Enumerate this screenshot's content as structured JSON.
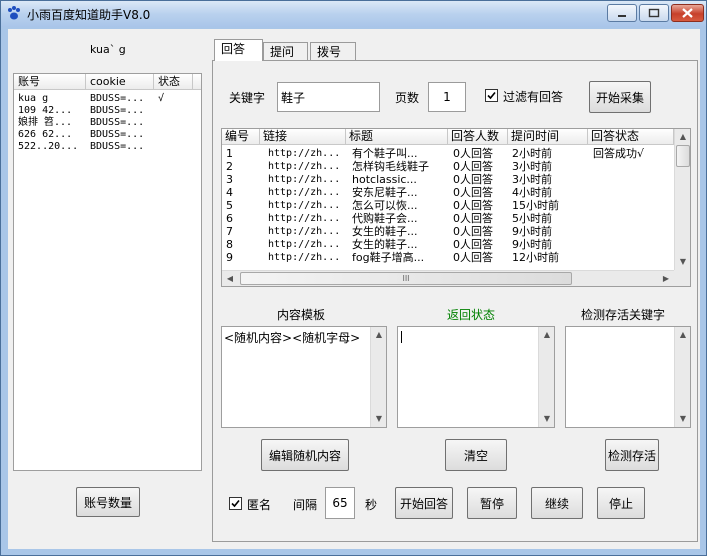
{
  "window": {
    "title": "小雨百度知道助手V8.0"
  },
  "left": {
    "account_name": "kua` g",
    "columns": [
      "账号",
      "cookie",
      "状态"
    ],
    "rows": [
      {
        "account": "kua  g",
        "cookie": "BDUSS=...",
        "status": "√"
      },
      {
        "account": "109  42...",
        "cookie": "BDUSS=...",
        "status": ""
      },
      {
        "account": "娘排  笤...",
        "cookie": "BDUSS=...",
        "status": ""
      },
      {
        "account": "626  62...",
        "cookie": "BDUSS=...",
        "status": ""
      },
      {
        "account": "522..20...",
        "cookie": "BDUSS=...",
        "status": ""
      }
    ],
    "account_count_button": "账号数量"
  },
  "tabs": [
    {
      "label": "回答"
    },
    {
      "label": "提问"
    },
    {
      "label": "拨号"
    }
  ],
  "search": {
    "keyword_label": "关键字",
    "keyword_value": "鞋子",
    "pages_label": "页数",
    "pages_value": "1",
    "filter_label": "过滤有回答",
    "filter_checked": true,
    "start_collect_button": "开始采集"
  },
  "results": {
    "columns": [
      "编号",
      "链接",
      "标题",
      "回答人数",
      "提问时间",
      "回答状态"
    ],
    "rows": [
      {
        "no": "1",
        "link": "http://zh...",
        "title": "有个鞋子叫...",
        "answers": "0人回答",
        "time": "2小时前",
        "status": "回答成功√"
      },
      {
        "no": "2",
        "link": "http://zh...",
        "title": "怎样钩毛线鞋子",
        "answers": "0人回答",
        "time": "3小时前",
        "status": ""
      },
      {
        "no": "3",
        "link": "http://zh...",
        "title": "hotclassic...",
        "answers": "0人回答",
        "time": "3小时前",
        "status": ""
      },
      {
        "no": "4",
        "link": "http://zh...",
        "title": "安东尼鞋子...",
        "answers": "0人回答",
        "time": "4小时前",
        "status": ""
      },
      {
        "no": "5",
        "link": "http://zh...",
        "title": "怎么可以恢...",
        "answers": "0人回答",
        "time": "15小时前",
        "status": ""
      },
      {
        "no": "6",
        "link": "http://zh...",
        "title": "代购鞋子会...",
        "answers": "0人回答",
        "time": "5小时前",
        "status": ""
      },
      {
        "no": "7",
        "link": "http://zh...",
        "title": "女生的鞋子...",
        "answers": "0人回答",
        "time": "9小时前",
        "status": ""
      },
      {
        "no": "8",
        "link": "http://zh...",
        "title": "女生的鞋子...",
        "answers": "0人回答",
        "time": "9小时前",
        "status": ""
      },
      {
        "no": "9",
        "link": "http://zh...",
        "title": "fog鞋子增高...",
        "answers": "0人回答",
        "time": "12小时前",
        "status": ""
      }
    ],
    "hscroll_grip": "III"
  },
  "sections": {
    "template_label": "内容模板",
    "return_status_label": "返回状态",
    "check_keywords_label": "检测存活关键字",
    "template_content": "<随机内容><随机字母>",
    "status_color": "#008000"
  },
  "actions": {
    "edit_random_button": "编辑随机内容",
    "clear_button": "清空",
    "check_alive_button": "检测存活",
    "anonymous_label": "匿名",
    "anonymous_checked": true,
    "interval_label": "间隔",
    "interval_value": "65",
    "seconds_label": "秒",
    "start_answer_button": "开始回答",
    "pause_button": "暂停",
    "continue_button": "继续",
    "stop_button": "停止"
  }
}
